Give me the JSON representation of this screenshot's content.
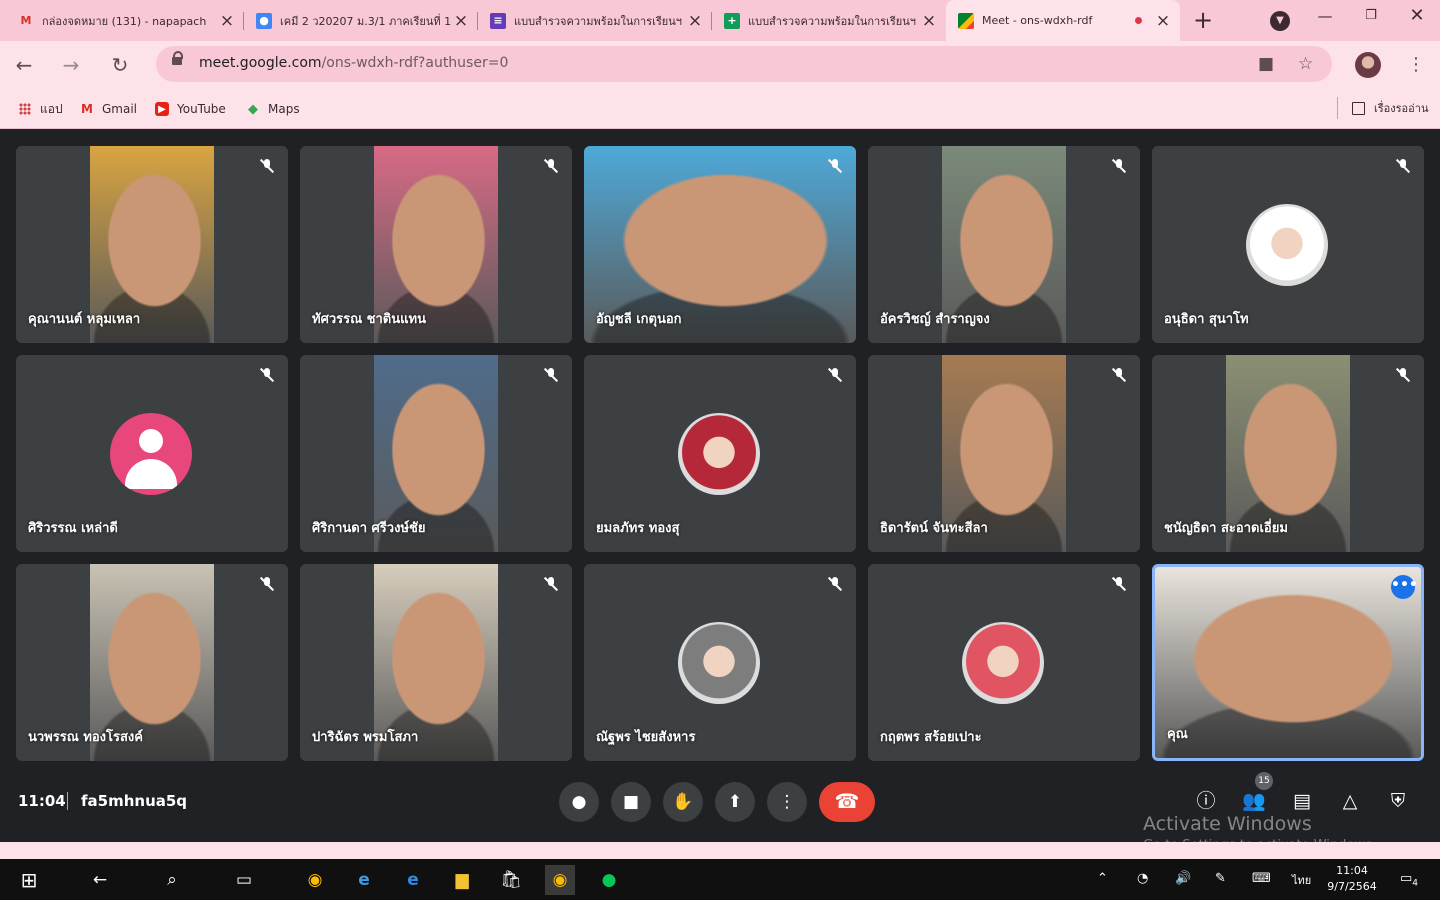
{
  "browser": {
    "tabs": [
      {
        "title": "กล่องจดหมาย (131) - napapach",
        "icon": "gmail-icon",
        "active": false
      },
      {
        "title": "เคมี 2 ว20207 ม.3/1 ภาคเรียนที่ 1",
        "icon": "classroom-icon",
        "active": false
      },
      {
        "title": "แบบสำรวจความพร้อมในการเรียนฯ",
        "icon": "forms-icon",
        "active": false
      },
      {
        "title": "แบบสำรวจความพร้อมในการเรียนฯ",
        "icon": "sheets-icon",
        "active": false
      },
      {
        "title": "Meet - ons-wdxh-rdf",
        "icon": "meet-icon",
        "active": true
      }
    ],
    "url_host": "meet.google.com",
    "url_path": "/ons-wdxh-rdf?authuser=0",
    "bookmarks": [
      {
        "label": "แอป",
        "icon": "apps-icon"
      },
      {
        "label": "Gmail",
        "icon": "gmail-icon"
      },
      {
        "label": "YouTube",
        "icon": "youtube-icon"
      },
      {
        "label": "Maps",
        "icon": "maps-icon"
      }
    ],
    "reading_list": "เรื่องรออ่าน"
  },
  "meet": {
    "participants": [
      {
        "name": "คุณานนต์ หลุมเหลา",
        "type": "video",
        "color": "#d9a441"
      },
      {
        "name": "ทัศวรรณ ชาตินแทน",
        "type": "video",
        "color": "#d86a86"
      },
      {
        "name": "อัญชลี เกตุนอก",
        "type": "video",
        "color": "#4ea9d8"
      },
      {
        "name": "อัครวิชญ์ สำราญจง",
        "type": "video",
        "color": "#7b8a7a"
      },
      {
        "name": "อนุธิดา สุนาโท",
        "type": "avatar",
        "color": "#ffffff"
      },
      {
        "name": "ศิริวรรณ เหล่าดี",
        "type": "initial",
        "color": "#e8477b"
      },
      {
        "name": "ศิริกานดา ศรีวงษ์ชัย",
        "type": "video",
        "color": "#4f6c8c"
      },
      {
        "name": "ยมลภัทร ทองสุ",
        "type": "avatar",
        "color": "#b5283a"
      },
      {
        "name": "ธิดารัตน์ จันทะสีลา",
        "type": "video",
        "color": "#a67b52"
      },
      {
        "name": "ชนัญธิดา สะอาดเอี่ยม",
        "type": "video",
        "color": "#8a8f72"
      },
      {
        "name": "นวพรรณ ทองโรสงค์",
        "type": "video",
        "color": "#c9c2b4"
      },
      {
        "name": "ปาริฉัตร พรมโสภา",
        "type": "video",
        "color": "#d6cdbc"
      },
      {
        "name": "ณัฐพร ไชยสังหาร",
        "type": "avatar",
        "color": "#7d7d7d"
      },
      {
        "name": "กฤตพร สร้อยเปาะ",
        "type": "avatar",
        "color": "#e05561"
      },
      {
        "name": "คุณ",
        "type": "video",
        "color": "#e9e4dc",
        "self": true
      }
    ],
    "time": "11:04",
    "meeting_code": "fa5mhnua5q",
    "people_count": "15"
  },
  "watermark": {
    "title": "Activate Windows",
    "subtitle": "Go to Settings to activate Windows."
  },
  "taskbar": {
    "lang": "ไทย",
    "time": "11:04",
    "date": "9/7/2564",
    "notifications": "4"
  },
  "colors": {
    "chrome_theme": "#f8c8d6",
    "meet_bg": "#202124",
    "tile_bg": "#3c4043",
    "hangup": "#ea4335",
    "self_border": "#8ab4f8"
  }
}
